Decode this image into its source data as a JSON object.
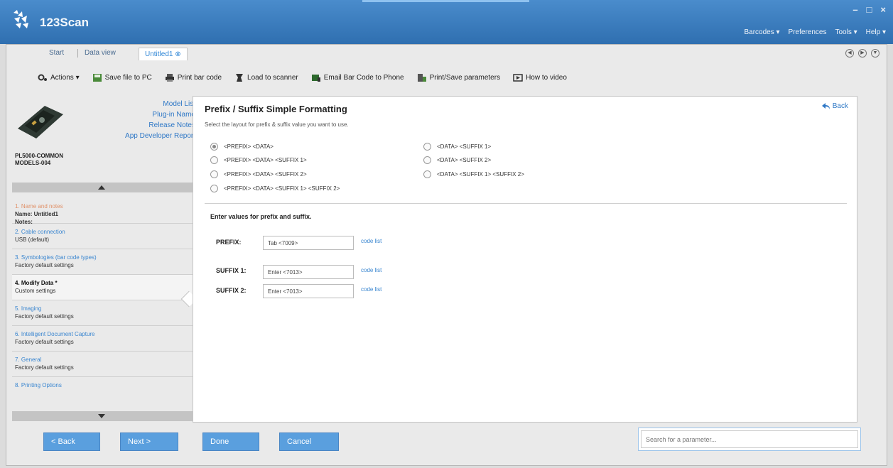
{
  "app": {
    "title": "123Scan"
  },
  "window_controls": [
    "–",
    "□",
    "×"
  ],
  "menubar": [
    {
      "label": "Barcodes ▾"
    },
    {
      "label": "Preferences"
    },
    {
      "label": "Tools ▾"
    },
    {
      "label": "Help ▾"
    }
  ],
  "tabs": {
    "start": "Start",
    "data_view": "Data view",
    "untitled": "Untitled1 ⊗"
  },
  "nav_circles": [
    "◀",
    "▶",
    "▼"
  ],
  "toolbar": {
    "actions": "Actions ▾",
    "save": "Save file to PC",
    "print": "Print bar code",
    "load": "Load to scanner",
    "email": "Email Bar Code to Phone",
    "print_save": "Print/Save parameters",
    "video": "How to video"
  },
  "sidebar": {
    "links": [
      "Model List",
      "Plug-in Name",
      "Release Notes",
      "App Developer Report"
    ],
    "model_line1": "PL5000-COMMON",
    "model_line2": "MODELS-004",
    "steps": [
      {
        "title": "1. Name and notes",
        "sub1": "Name: Untitled1",
        "sub2": "Notes:"
      },
      {
        "title": "2. Cable connection",
        "sub1": "USB (default)",
        "sub2": ""
      },
      {
        "title": "3. Symbologies (bar code types)",
        "sub1": "Factory default settings",
        "sub2": ""
      },
      {
        "title": "4. Modify Data *",
        "sub1": "Custom settings",
        "sub2": ""
      },
      {
        "title": "5. Imaging",
        "sub1": "Factory default settings",
        "sub2": ""
      },
      {
        "title": "6. Intelligent Document Capture",
        "sub1": "Factory default settings",
        "sub2": ""
      },
      {
        "title": "7. General",
        "sub1": "Factory default settings",
        "sub2": ""
      },
      {
        "title": "8. Printing Options",
        "sub1": "",
        "sub2": ""
      }
    ]
  },
  "main": {
    "title": "Prefix / Suffix Simple Formatting",
    "back": "Back",
    "instruction": "Select the layout for prefix & suffix value you want to use.",
    "options_left": [
      "<PREFIX> <DATA>",
      "<PREFIX> <DATA> <SUFFIX 1>",
      "<PREFIX> <DATA> <SUFFIX 2>",
      "<PREFIX> <DATA> <SUFFIX 1> <SUFFIX 2>"
    ],
    "options_right": [
      "<DATA> <SUFFIX 1>",
      "<DATA> <SUFFIX 2>",
      "<DATA> <SUFFIX 1> <SUFFIX 2>"
    ],
    "selected_option": "<PREFIX> <DATA>",
    "values_heading": "Enter values for prefix and suffix.",
    "prefix_label": "PREFIX:",
    "prefix_value": "Tab <7009>",
    "suffix1_label": "SUFFIX 1:",
    "suffix1_value": "Enter <7013>",
    "suffix2_label": "SUFFIX 2:",
    "suffix2_value": "Enter <7013>",
    "code_list": "code list"
  },
  "buttons": {
    "back": "< Back",
    "next": "Next >",
    "done": "Done",
    "cancel": "Cancel"
  },
  "search": {
    "placeholder": "Search for a parameter..."
  },
  "colors": {
    "titlebar": "#2f6fb0",
    "accent": "#5a9fde",
    "link": "#2f78c6"
  }
}
